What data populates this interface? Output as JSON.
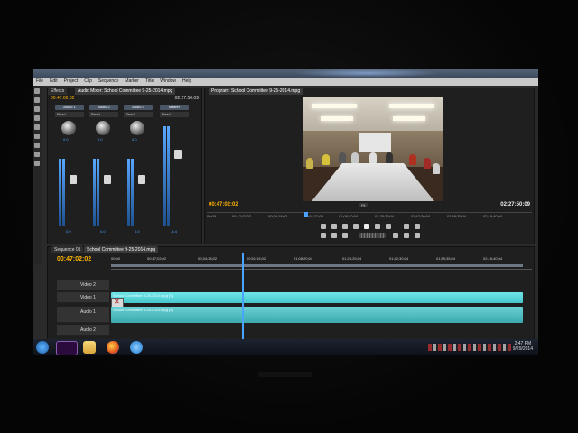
{
  "menu": [
    "File",
    "Edit",
    "Project",
    "Clip",
    "Sequence",
    "Marker",
    "Title",
    "Window",
    "Help"
  ],
  "mixer": {
    "tabs": [
      "Effects",
      "Audio Mixer: School Committee 9-25-2014.mpg"
    ],
    "channels": [
      {
        "name": "Audio 1",
        "mode": "Read",
        "pan": "0.0",
        "level": "0.0"
      },
      {
        "name": "Audio 2",
        "mode": "Read",
        "pan": "0.0",
        "level": "0.0"
      },
      {
        "name": "Audio 3",
        "mode": "Read",
        "pan": "0.0",
        "level": "0.0"
      },
      {
        "name": "Master",
        "mode": "Read",
        "pan": "",
        "level": "-4.4"
      }
    ],
    "timecode": "00:47:02:02",
    "duration": "02:27:50:09"
  },
  "program": {
    "tab": "Program: School Committee 9-25-2014.mpg",
    "current_tc": "00:47:02:02",
    "duration_tc": "02:27:50:09",
    "fit": "Fit",
    "ruler": [
      "00;00",
      "00;17;03;02",
      "00;34;18;02",
      "00;51;22;02",
      "01;08;20;04",
      "01;25;25;04",
      "01;42;30;04",
      "01;59;35;04",
      "02;16;40;04"
    ]
  },
  "timeline": {
    "tabs": [
      "Sequence 01",
      "School Committee 9-25-2014.mpg"
    ],
    "timecode": "00:47:02:02",
    "ruler": [
      "00;00",
      "00;17;03;02",
      "00;34;18;02",
      "00;51;15;02",
      "01;08;20;04",
      "01;25;25;04",
      "01;42;30;04",
      "01;59;35;04",
      "02;16;40;04"
    ],
    "tracks": [
      {
        "name": "Video 2",
        "clip": ""
      },
      {
        "name": "Video 1",
        "clip": "School Committee 9-25-2014.mpg [V]"
      },
      {
        "name": "Audio 1",
        "clip": "School Committee 9-25-2014.mpg [A]"
      },
      {
        "name": "Audio 2",
        "clip": ""
      }
    ]
  },
  "taskbar": {
    "time": "2:47 PM",
    "date": "9/29/2014",
    "apps": [
      "start-orb",
      "premiere",
      "explorer",
      "firefox",
      "internet-explorer"
    ]
  }
}
